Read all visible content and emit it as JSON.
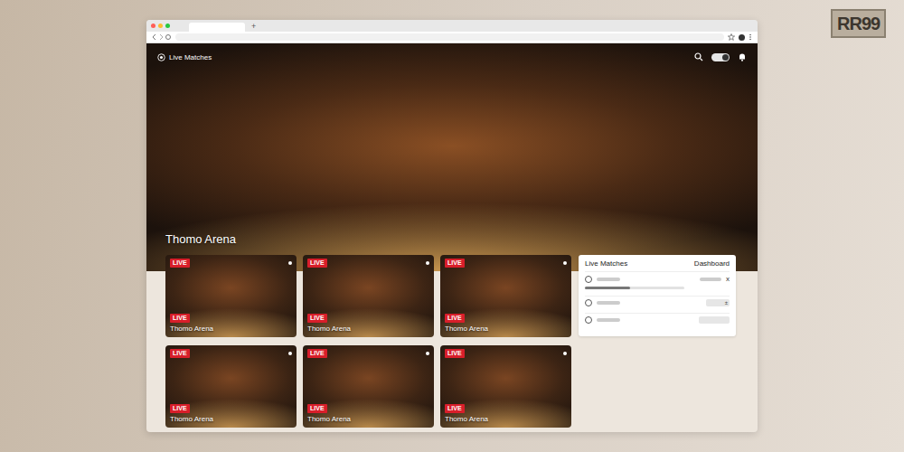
{
  "logo": "RR99",
  "browser": {
    "new_tab": "+"
  },
  "header": {
    "title": "Live Matches",
    "toggle": {
      "on": true
    }
  },
  "hero": {
    "caption": "Thomo Arena"
  },
  "matches": [
    {
      "badge": "LIVE",
      "tag": "LIVE",
      "name": "Thomo Arena"
    },
    {
      "badge": "LIVE",
      "tag": "LIVE",
      "name": "Thomo Arena"
    },
    {
      "badge": "LIVE",
      "tag": "LIVE",
      "name": "Thomo Arena"
    },
    {
      "badge": "LIVE",
      "tag": "LIVE",
      "name": "Thomo Arena"
    },
    {
      "badge": "LIVE",
      "tag": "LIVE",
      "name": "Thomo Arena"
    },
    {
      "badge": "LIVE",
      "tag": "LIVE",
      "name": "Thomo Arena"
    }
  ],
  "panel": {
    "title": "Live Matches",
    "link": "Dashboard",
    "rows": [
      {
        "kind": "progress",
        "level": 0.45,
        "mark": "x"
      },
      {
        "kind": "box",
        "mark": "±"
      },
      {
        "kind": "plain",
        "mark": ""
      }
    ]
  }
}
